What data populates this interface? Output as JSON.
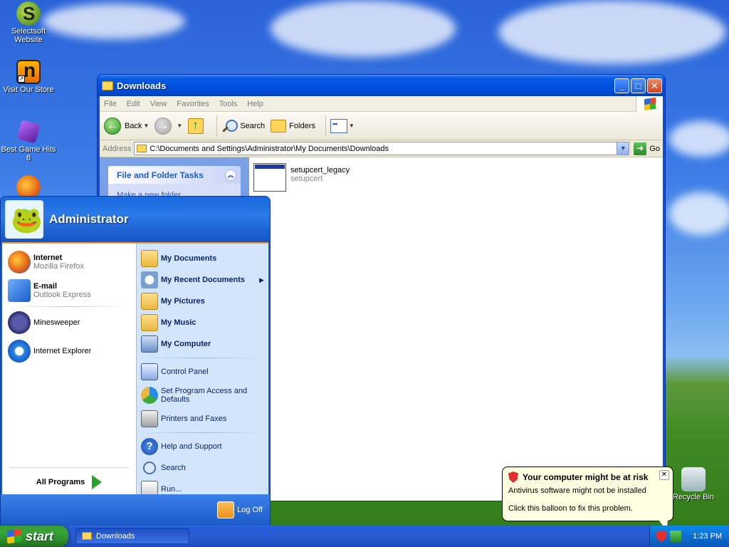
{
  "desktop": {
    "icons": [
      {
        "label": "Selectsoft Website"
      },
      {
        "label": "Visit Our Store"
      },
      {
        "label": "Best Game Hits 8"
      },
      {
        "label": "Mozilla Firefox"
      },
      {
        "label": "Recycle Bin"
      }
    ]
  },
  "window": {
    "title": "Downloads",
    "menu": [
      "File",
      "Edit",
      "View",
      "Favorites",
      "Tools",
      "Help"
    ],
    "toolbar": {
      "back_label": "Back",
      "search_label": "Search",
      "folders_label": "Folders"
    },
    "address": {
      "label": "Address",
      "value": "C:\\Documents and Settings\\Administrator\\My Documents\\Downloads",
      "go_label": "Go"
    },
    "taskpane": {
      "title": "File and Folder Tasks",
      "first_task": "Make a new folder"
    },
    "files": [
      {
        "name": "setupcert_legacy",
        "sub": "setupcert"
      }
    ]
  },
  "start_menu": {
    "user": "Administrator",
    "pinned": [
      {
        "primary": "Internet",
        "secondary": "Mozilla Firefox"
      },
      {
        "primary": "E-mail",
        "secondary": "Outlook Express"
      }
    ],
    "recent": [
      {
        "label": "Minesweeper"
      },
      {
        "label": "Internet Explorer"
      }
    ],
    "all_programs": "All Programs",
    "right": {
      "my_documents": "My Documents",
      "my_recent_documents": "My Recent Documents",
      "my_pictures": "My Pictures",
      "my_music": "My Music",
      "my_computer": "My Computer",
      "control_panel": "Control Panel",
      "set_program_access": "Set Program Access and Defaults",
      "printers_faxes": "Printers and Faxes",
      "help_support": "Help and Support",
      "search": "Search",
      "run": "Run..."
    },
    "log_off": "Log Off"
  },
  "taskbar": {
    "start_label": "start",
    "task_button": "Downloads",
    "clock": "1:23 PM"
  },
  "balloon": {
    "title": "Your computer might be at risk",
    "line1": "Antivirus software might not be installed",
    "line2": "Click this balloon to fix this problem."
  }
}
